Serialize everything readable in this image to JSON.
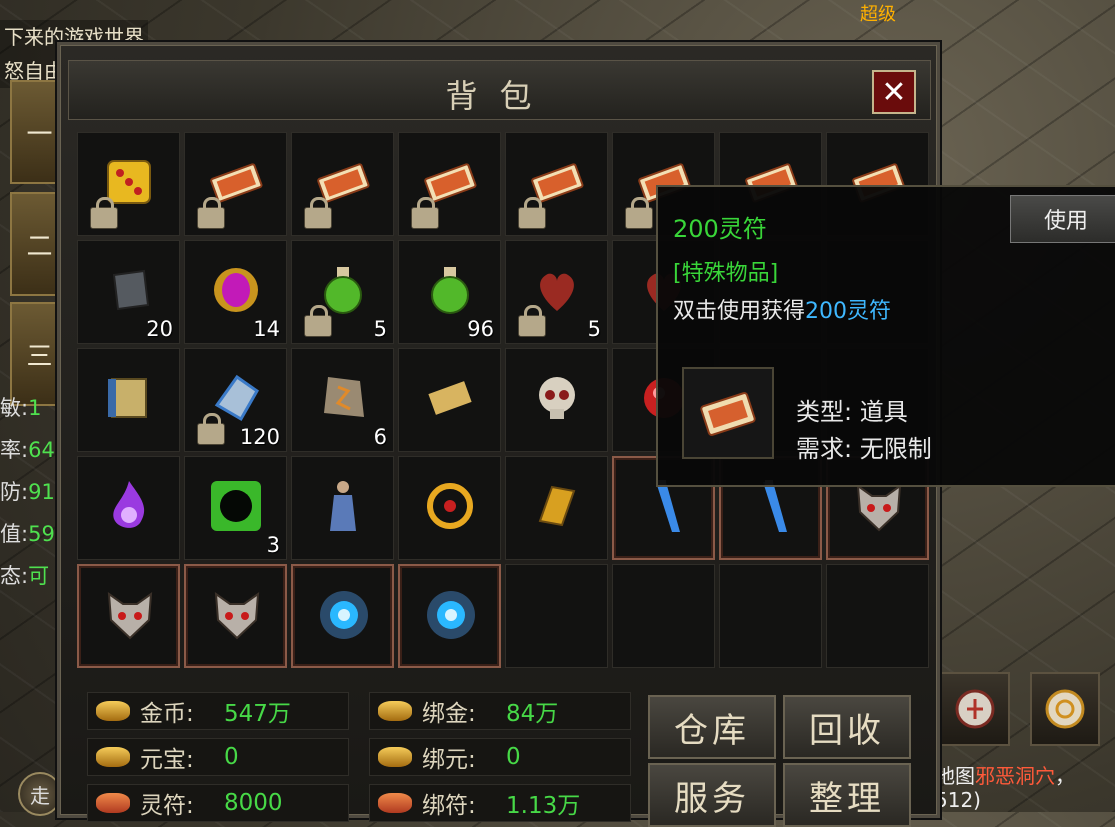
{
  "background": {
    "chat_lines": [
      "下来的游戏世界",
      "怒自由"
    ],
    "top_label": "超级",
    "stats": [
      {
        "label": "敏:",
        "value": "1"
      },
      {
        "label": "率:",
        "value": "64"
      },
      {
        "label": "防:",
        "value": "91"
      },
      {
        "label": "值:",
        "value": "59"
      },
      {
        "label": "态:",
        "value": "可"
      }
    ],
    "side_tabs": [
      "一",
      "二",
      "三"
    ],
    "map_text_prefix": "地图",
    "map_text_name": "邪恶洞穴",
    "map_text_suffix": "，",
    "map_coord": "512)",
    "walk_button": "走"
  },
  "bag": {
    "title": "背包",
    "close_label": "✕",
    "slots": [
      {
        "icon": "dice-icon",
        "locked": true,
        "count": ""
      },
      {
        "icon": "talisman-icon",
        "locked": true,
        "count": ""
      },
      {
        "icon": "talisman-icon",
        "locked": true,
        "count": ""
      },
      {
        "icon": "talisman-icon",
        "locked": true,
        "count": ""
      },
      {
        "icon": "talisman-icon",
        "locked": true,
        "count": ""
      },
      {
        "icon": "talisman-icon",
        "locked": true,
        "count": ""
      },
      {
        "icon": "talisman-icon",
        "locked": false,
        "count": ""
      },
      {
        "icon": "talisman-icon",
        "locked": false,
        "count": ""
      },
      {
        "icon": "stone-icon",
        "locked": false,
        "count": "20"
      },
      {
        "icon": "purple-gem-icon",
        "locked": false,
        "count": "14"
      },
      {
        "icon": "green-potion-icon",
        "locked": true,
        "count": "5"
      },
      {
        "icon": "green-potion-icon",
        "locked": false,
        "count": "96"
      },
      {
        "icon": "heart-icon",
        "locked": true,
        "count": "5"
      },
      {
        "icon": "heart-icon",
        "locked": false,
        "count": ""
      },
      {
        "icon": "empty",
        "locked": false,
        "count": ""
      },
      {
        "icon": "empty",
        "locked": false,
        "count": ""
      },
      {
        "icon": "scroll-book-icon",
        "locked": false,
        "count": ""
      },
      {
        "icon": "crystal-icon",
        "locked": true,
        "count": "120"
      },
      {
        "icon": "rune-stone-icon",
        "locked": false,
        "count": "6"
      },
      {
        "icon": "scroll-icon",
        "locked": false,
        "count": ""
      },
      {
        "icon": "skull-icon",
        "locked": false,
        "count": ""
      },
      {
        "icon": "red-orb-icon",
        "locked": false,
        "count": ""
      },
      {
        "icon": "empty",
        "locked": false,
        "count": ""
      },
      {
        "icon": "empty",
        "locked": false,
        "count": ""
      },
      {
        "icon": "purple-flame-icon",
        "locked": false,
        "count": ""
      },
      {
        "icon": "green-portal-icon",
        "locked": false,
        "count": "3"
      },
      {
        "icon": "warrior-figure-icon",
        "locked": false,
        "count": ""
      },
      {
        "icon": "gold-amulet-icon",
        "locked": false,
        "count": ""
      },
      {
        "icon": "gold-bracer-icon",
        "locked": false,
        "count": ""
      },
      {
        "icon": "blue-sword-icon",
        "locked": false,
        "count": "",
        "framed": true
      },
      {
        "icon": "blue-sword-icon",
        "locked": false,
        "count": "",
        "framed": true
      },
      {
        "icon": "wolf-mask-icon",
        "locked": false,
        "count": "",
        "framed": true
      },
      {
        "icon": "wolf-mask-icon",
        "locked": false,
        "count": "",
        "framed": true
      },
      {
        "icon": "wolf-mask-icon",
        "locked": false,
        "count": "",
        "framed": true
      },
      {
        "icon": "blue-gear-icon",
        "locked": false,
        "count": "",
        "framed": true
      },
      {
        "icon": "blue-gear-icon",
        "locked": false,
        "count": "",
        "framed": true
      },
      {
        "icon": "empty",
        "locked": false,
        "count": ""
      },
      {
        "icon": "empty",
        "locked": false,
        "count": ""
      },
      {
        "icon": "empty",
        "locked": false,
        "count": ""
      },
      {
        "icon": "empty",
        "locked": false,
        "count": ""
      }
    ],
    "currency": [
      {
        "label": "金币:",
        "value": "547万",
        "icon": "gold-coins-icon"
      },
      {
        "label": "绑金:",
        "value": "84万",
        "icon": "gold-coins-icon"
      },
      {
        "label": "元宝:",
        "value": "0",
        "icon": "ingot-icon"
      },
      {
        "label": "绑元:",
        "value": "0",
        "icon": "ingot-icon"
      },
      {
        "label": "灵符:",
        "value": "8000",
        "icon": "talisman-icon"
      },
      {
        "label": "绑符:",
        "value": "1.13万",
        "icon": "talisman-icon"
      }
    ],
    "buttons": {
      "warehouse": "仓库",
      "recycle": "回收",
      "service": "服务",
      "sort": "整理"
    }
  },
  "tooltip": {
    "name": "200灵符",
    "category": "[特殊物品]",
    "desc_prefix": "双击使用获得",
    "desc_highlight": "200灵符",
    "use_button": "使用",
    "type_label": "类型:",
    "type_value": "道具",
    "req_label": "需求:",
    "req_value": "无限制"
  },
  "colors": {
    "value_green": "#47d947",
    "highlight_blue": "#3fb8ff",
    "frame_red": "#8b5a48"
  }
}
